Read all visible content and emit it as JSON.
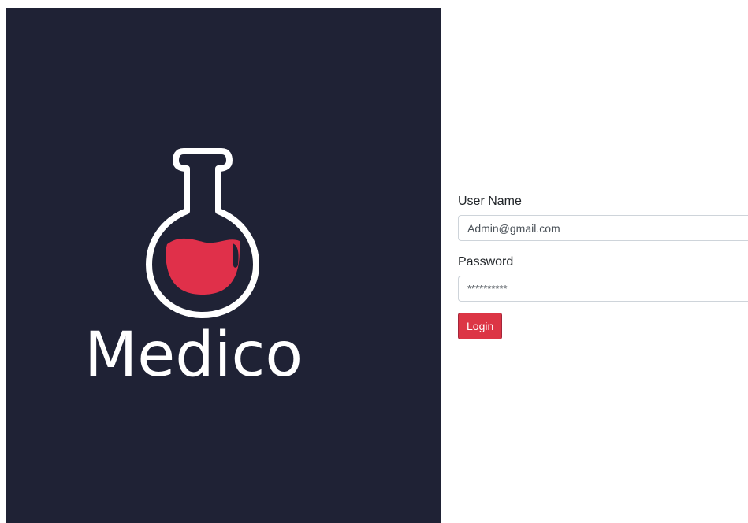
{
  "brand": {
    "name": "Medico",
    "logo_icon": "flask-icon",
    "panel_color": "#1f2235",
    "accent_color": "#e0304a"
  },
  "login_form": {
    "username_label": "User Name",
    "username_value": "Admin@gmail.com",
    "password_label": "Password",
    "password_value": "**********",
    "login_label": "Login",
    "button_color": "#dc3545"
  }
}
